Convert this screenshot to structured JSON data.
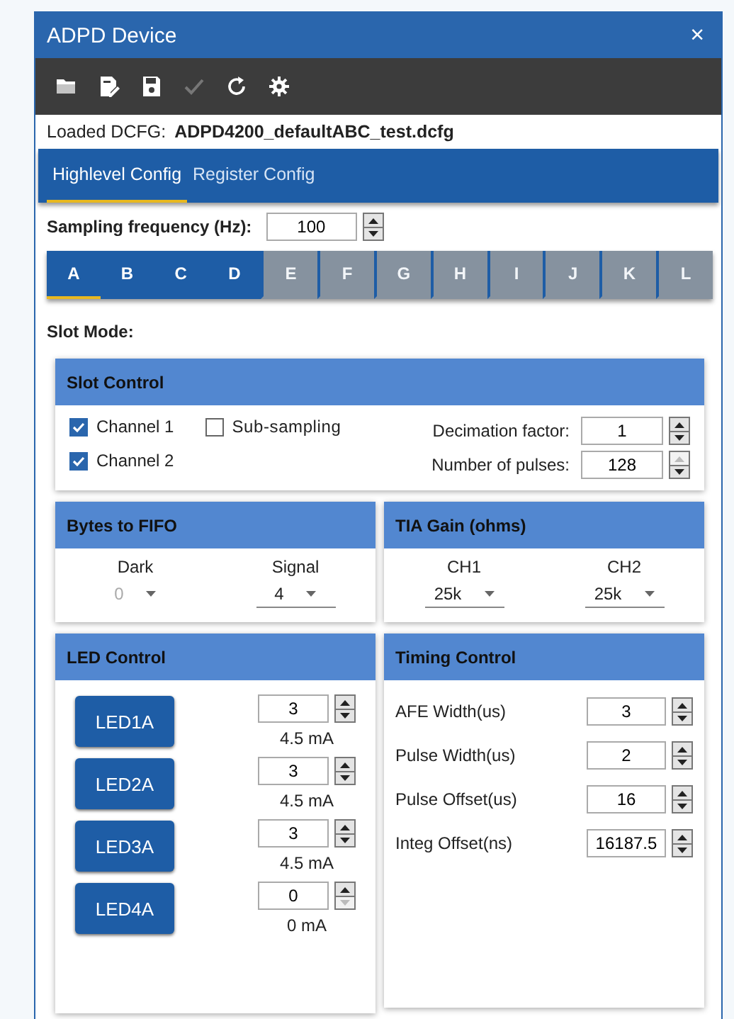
{
  "window": {
    "title": "ADPD Device",
    "close": "×"
  },
  "toolbar": [
    {
      "kind": "folder",
      "disabled": false
    },
    {
      "kind": "edit",
      "disabled": false
    },
    {
      "kind": "save",
      "disabled": false
    },
    {
      "kind": "check",
      "disabled": true
    },
    {
      "kind": "refresh",
      "disabled": false
    },
    {
      "kind": "gear",
      "disabled": false
    }
  ],
  "loaded": {
    "label": "Loaded DCFG:",
    "file": "ADPD4200_defaultABC_test.dcfg"
  },
  "tabs": [
    {
      "label": "Highlevel Config",
      "selected": true
    },
    {
      "label": "Register Config",
      "selected": false
    }
  ],
  "sampling": {
    "label": "Sampling frequency (Hz):",
    "value": "100",
    "up_disabled": false,
    "down_disabled": false
  },
  "slots": [
    {
      "label": "A",
      "selected": true,
      "disabled": false
    },
    {
      "label": "B",
      "selected": false,
      "disabled": false
    },
    {
      "label": "C",
      "selected": false,
      "disabled": false
    },
    {
      "label": "D",
      "selected": false,
      "disabled": false
    },
    {
      "label": "E",
      "selected": false,
      "disabled": true
    },
    {
      "label": "F",
      "selected": false,
      "disabled": true
    },
    {
      "label": "G",
      "selected": false,
      "disabled": true
    },
    {
      "label": "H",
      "selected": false,
      "disabled": true
    },
    {
      "label": "I",
      "selected": false,
      "disabled": true
    },
    {
      "label": "J",
      "selected": false,
      "disabled": true
    },
    {
      "label": "K",
      "selected": false,
      "disabled": true
    },
    {
      "label": "L",
      "selected": false,
      "disabled": true
    }
  ],
  "slot_mode": "Slot Mode:",
  "slot_control": {
    "title": "Slot Control",
    "checkboxes": [
      {
        "label": "Channel 1",
        "checked": true
      },
      {
        "label": "Channel 2",
        "checked": true
      },
      {
        "label": "Sub-sampling",
        "checked": false
      }
    ],
    "spinners": [
      {
        "label": "Decimation factor:",
        "value": "1",
        "up_disabled": false,
        "down_disabled": false
      },
      {
        "label": "Number of pulses:",
        "value": "128",
        "up_disabled": true,
        "down_disabled": false
      }
    ]
  },
  "bytes_to_fifo": {
    "title": "Bytes to FIFO",
    "dropdowns": [
      {
        "label": "Dark",
        "value": "0",
        "disabled": true
      },
      {
        "label": "Signal",
        "value": "4",
        "disabled": false
      }
    ]
  },
  "tia_gain": {
    "title": "TIA Gain (ohms)",
    "dropdowns": [
      {
        "label": "CH1",
        "value": "25k",
        "disabled": false
      },
      {
        "label": "CH2",
        "value": "25k",
        "disabled": false
      }
    ]
  },
  "led_control": {
    "title": "LED Control",
    "leds": [
      {
        "button": "LED1A",
        "value": "3",
        "current": "4.5  mA",
        "up_disabled": false,
        "down_disabled": false
      },
      {
        "button": "LED2A",
        "value": "3",
        "current": "4.5  mA",
        "up_disabled": false,
        "down_disabled": false
      },
      {
        "button": "LED3A",
        "value": "3",
        "current": "4.5  mA",
        "up_disabled": false,
        "down_disabled": false
      },
      {
        "button": "LED4A",
        "value": "0",
        "current": "0  mA",
        "up_disabled": false,
        "down_disabled": true
      }
    ]
  },
  "timing_control": {
    "title": "Timing Control",
    "rows": [
      {
        "label": "AFE Width(us)",
        "value": "3",
        "up_disabled": false,
        "down_disabled": false
      },
      {
        "label": "Pulse Width(us)",
        "value": "2",
        "up_disabled": false,
        "down_disabled": false
      },
      {
        "label": "Pulse Offset(us)",
        "value": "16",
        "up_disabled": false,
        "down_disabled": false
      },
      {
        "label": "Integ Offset(ns)",
        "value": "16187.5",
        "up_disabled": false,
        "down_disabled": false
      }
    ]
  }
}
